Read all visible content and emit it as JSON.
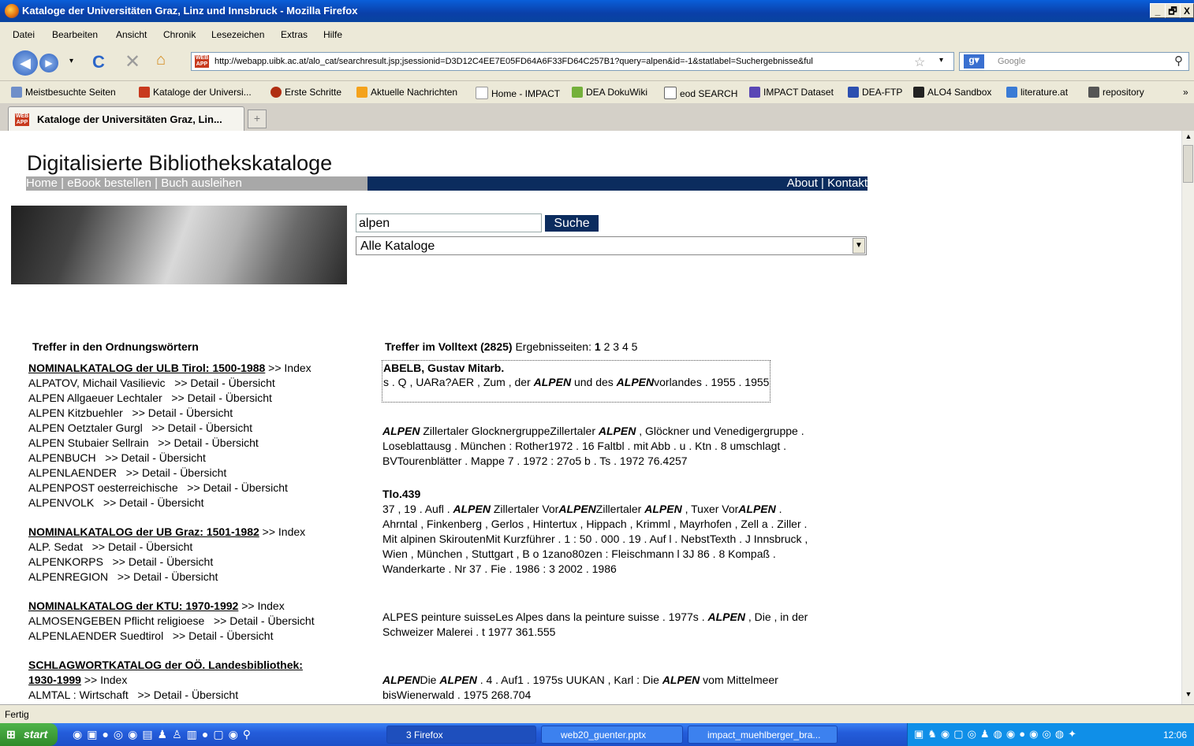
{
  "window": {
    "title": "Kataloge der Universitäten Graz, Linz und Innsbruck - Mozilla Firefox",
    "controls": [
      "_",
      "🗗",
      "X"
    ]
  },
  "menu": [
    "Datei",
    "Bearbeiten",
    "Ansicht",
    "Chronik",
    "Lesezeichen",
    "Extras",
    "Hilfe"
  ],
  "nav": {
    "url": "http://webapp.uibk.ac.at/alo_cat/searchresult.jsp;jsessionid=D3D12C4EE7E05FD64A6F33FD64C257B1?query=alpen&id=-1&statlabel=Suchergebnisse&ful",
    "search_placeholder": "Google"
  },
  "bookmarks": [
    "Meistbesuchte Seiten",
    "Kataloge der Universi...",
    "Erste Schritte",
    "Aktuelle Nachrichten",
    "Home - IMPACT",
    "DEA DokuWiki",
    "eod SEARCH",
    "IMPACT Dataset",
    "DEA-FTP",
    "ALO4 Sandbox",
    "literature.at",
    "repository"
  ],
  "tab": {
    "label": "Kataloge der Universitäten Graz, Lin..."
  },
  "page": {
    "heading": "Digitalisierte Bibliothekskataloge",
    "nav_left": "Home | eBook bestellen | Buch ausleihen",
    "nav_right": "About | Kontakt",
    "search_value": "alpen",
    "search_button": "Suche",
    "catalog_select": "Alle Kataloge",
    "left_title": "Treffer in den Ordnungswörtern",
    "index_link": ">> Index",
    "detail_link": ">> Detail - Übersicht",
    "catalogs": [
      {
        "name": "NOMINALKATALOG der ULB Tirol: 1500-1988",
        "entries": [
          "ALPATOV, Michail Vasilievic",
          "ALPEN Allgaeuer Lechtaler",
          "ALPEN Kitzbuehler",
          "ALPEN Oetztaler Gurgl",
          "ALPEN Stubaier Sellrain",
          "ALPENBUCH",
          "ALPENLAENDER",
          "ALPENPOST oesterreichische",
          "ALPENVOLK"
        ]
      },
      {
        "name": "NOMINALKATALOG der UB Graz: 1501-1982",
        "entries": [
          "ALP. Sedat",
          "ALPENKORPS",
          "ALPENREGION"
        ]
      },
      {
        "name": "NOMINALKATALOG der KTU: 1970-1992",
        "entries": [
          "ALMOSENGEBEN Pflicht religioese",
          "ALPENLAENDER Suedtirol"
        ]
      },
      {
        "name_line1": "SCHLAGWORTKATALOG der OÖ. Landesbibliothek:",
        "name_line2": "1930-1999",
        "entries": [
          "ALMTAL : Wirtschaft"
        ]
      }
    ],
    "right_title": "Treffer im Volltext (2825)",
    "pages_label": "Ergebnisseiten:",
    "pages": [
      "1",
      "2",
      "3",
      "4",
      "5"
    ],
    "results": {
      "r1_title": "ABELB, Gustav Mitarb.",
      "r1_a": "s . Q , UARa?AER , Zum , der ",
      "r1_b": "ALPEN",
      "r1_c": " und des ",
      "r1_d": "ALPEN",
      "r1_e": "vorlandes . 1955 . 1955",
      "r2_l1_a": "ALPEN",
      "r2_l1_b": " Zillertaler GlocknergruppeZillertaler ",
      "r2_l1_c": "ALPEN",
      "r2_l1_d": " , Glöckner und Venedigergruppe .",
      "r2_l2": "Loseblattausg . München : Rother1972 . 16 Faltbl . mit Abb . u . Ktn . 8 umschlagt .",
      "r2_l3": "BVTourenblätter . Mappe 7 . 1972 : 27o5 b . Ts . 1972 76.4257",
      "r3_title": "Tlo.439",
      "r3_l1_a": "37 , 19 . Aufl . ",
      "r3_l1_b": "ALPEN",
      "r3_l1_c": " Zillertaler Vor",
      "r3_l1_d": "ALPEN",
      "r3_l1_e": "Zillertaler ",
      "r3_l1_f": "ALPEN",
      "r3_l1_g": " , Tuxer Vor",
      "r3_l1_h": "ALPEN",
      "r3_l1_i": " .",
      "r3_l2": "Ahrntal , Finkenberg , Gerlos , Hintertux , Hippach , Krimml , Mayrhofen , Zell a . Ziller .",
      "r3_l3": "Mit alpinen SkiroutenMit Kurzführer . 1 : 50 . 000 . 19 . Auf l . NebstTexth . J Innsbruck ,",
      "r3_l4": "Wien , München , Stuttgart , B o 1zano80zen : Fleischmann l 3J 86 . 8 Kompaß .",
      "r3_l5": "Wanderkarte . Nr 37 . Fie . 1986 : 3 2002 . 1986",
      "r4_l1_a": "ALPES peinture suisseLes Alpes dans la peinture suisse . 1977s . ",
      "r4_l1_b": "ALPEN",
      "r4_l1_c": " , Die , in der",
      "r4_l2": "Schweizer Malerei . t 1977 361.555",
      "r5_l1_a": "ALPEN",
      "r5_l1_b": "Die ",
      "r5_l1_c": "ALPEN",
      "r5_l1_d": " . 4 . Auf1 . 1975s UUKAN , Karl : Die ",
      "r5_l1_e": "ALPEN",
      "r5_l1_f": " vom Mittelmeer",
      "r5_l2": "bisWienerwald . 1975 268.704"
    }
  },
  "status": "Fertig",
  "taskbar": {
    "start": "start",
    "tasks": [
      "3 Firefox",
      "web20_guenter.pptx",
      "impact_muehlberger_bra..."
    ],
    "clock": "12:06"
  }
}
